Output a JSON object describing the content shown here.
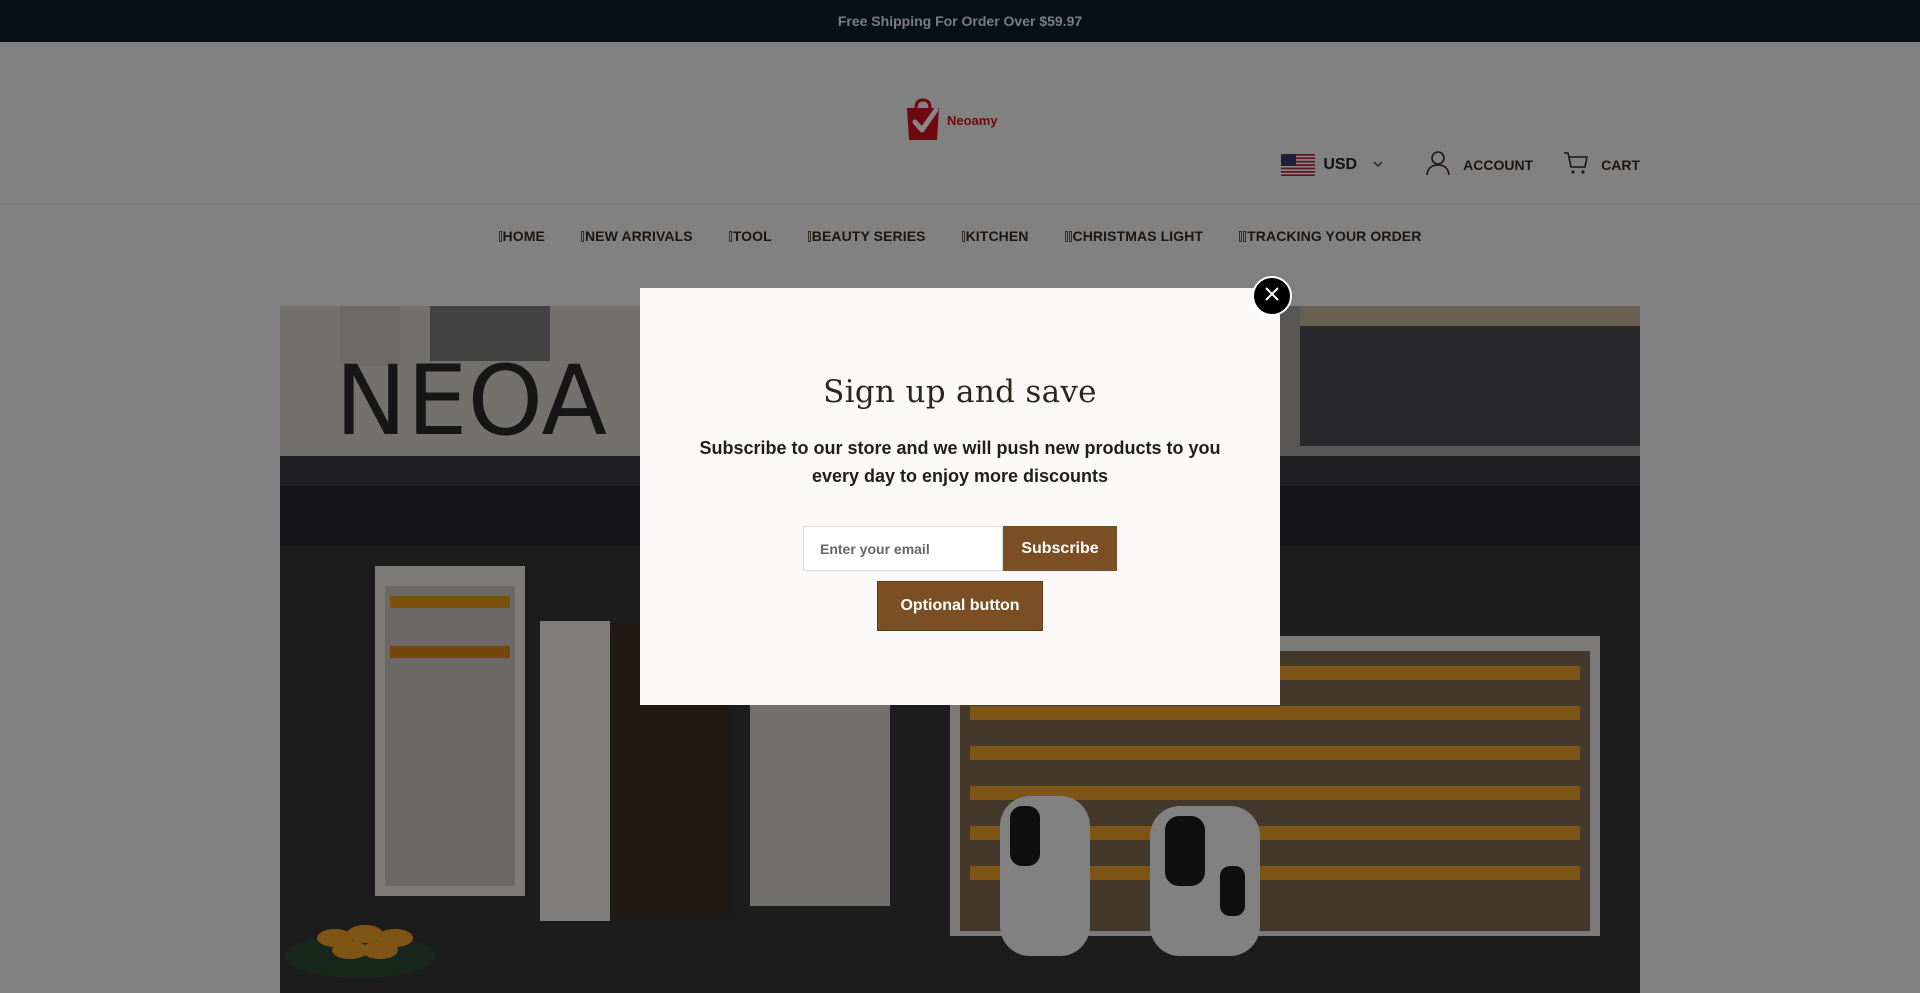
{
  "announcement": {
    "text": "Free Shipping For Order Over $59.97"
  },
  "header": {
    "logo_text": "Neoamy",
    "currency": {
      "label": "USD",
      "flag": "us-flag-icon"
    },
    "account_label": "ACCOUNT",
    "cart_label": "CART"
  },
  "nav": {
    "items": [
      {
        "label": "HOME"
      },
      {
        "label": "NEW ARRIVALS"
      },
      {
        "label": "TOOL"
      },
      {
        "label": "BEAUTY SERIES"
      },
      {
        "label": "KITCHEN"
      },
      {
        "label": "CHRISTMAS LIGHT"
      },
      {
        "label": "TRACKING YOUR ORDER"
      }
    ]
  },
  "hero": {
    "sign_text": "NEOA"
  },
  "modal": {
    "title": "Sign up and save",
    "text": "Subscribe to our store and we will push new products to you every day to enjoy more discounts",
    "email_placeholder": "Enter your email",
    "subscribe_label": "Subscribe",
    "optional_label": "Optional button"
  },
  "colors": {
    "announcement_bg": "#0f1d2e",
    "brand_brown": "#7b4e24",
    "logo_red": "#d4121d"
  }
}
